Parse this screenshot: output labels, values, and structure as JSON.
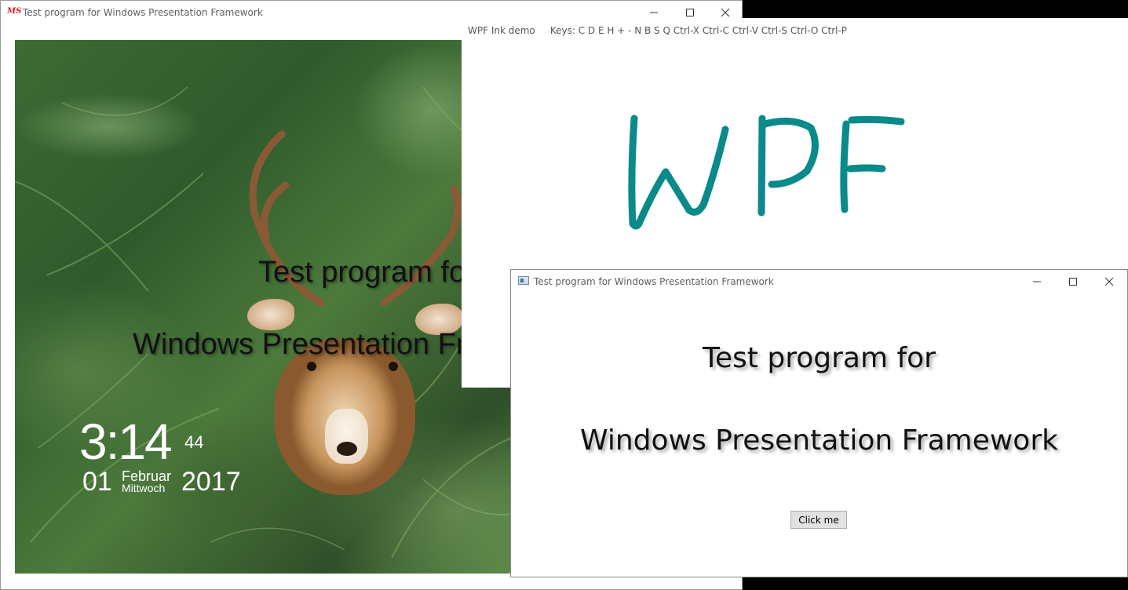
{
  "window_main": {
    "app_icon_text": "MS",
    "title": "Test program for Windows Presentation Framework",
    "overlay_line1": "Test program for",
    "overlay_line2": "Windows Presentation Framework",
    "clock": {
      "time": "3:14",
      "seconds": "44",
      "day": "01",
      "month": "Februar",
      "weekday": "Mittwoch",
      "year": "2017"
    }
  },
  "window_ink": {
    "title": "WPF Ink demo     Keys: C D E H + - N B S Q Ctrl-X Ctrl-C Ctrl-V Ctrl-S Ctrl-O Ctrl-P",
    "ink_color": "#0a8a8a",
    "ink_text": "WPF"
  },
  "window_front": {
    "title": "Test program for Windows Presentation Framework",
    "line1": "Test program for",
    "line2": "Windows Presentation Framework",
    "button_label": "Click me"
  },
  "icons": [
    "minimize-icon",
    "maximize-icon",
    "close-icon"
  ]
}
